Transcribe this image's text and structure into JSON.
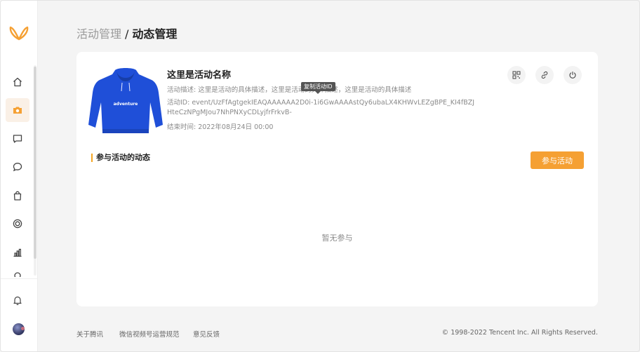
{
  "breadcrumb": {
    "parent": "活动管理",
    "separator": "/",
    "current": "动态管理"
  },
  "activity": {
    "title": "这里是活动名称",
    "description": "活动描述: 这里是活动的具体描述，这里是活动的具体描述，这里是活动的具体描述",
    "id_text": "活动ID: event/UzFfAgtgekIEAQAAAAAA2D0i-1i6GwAAAAstQy6ubaLX4KHWvLEZgBPE_KI4fBZJHteCzNPgMJou7NhPNXyCDLyjfrFrkvB-",
    "end_time": "结束时间: 2022年08月24日 00:00",
    "tooltip": "复制活动ID",
    "product_print": "adventure"
  },
  "section": {
    "title": "参与活动的动态",
    "join_label": "参与活动",
    "empty_text": "暂无参与"
  },
  "footer": {
    "links": [
      "关于腾讯",
      "微信视频号运营规范",
      "意见反馈"
    ],
    "copyright": "© 1998-2022 Tencent Inc. All Rights Reserved."
  },
  "sidebar": {
    "items": [
      "home-icon",
      "camera-icon",
      "message-square-icon",
      "chat-bubble-icon",
      "shopping-bag-icon",
      "target-icon",
      "bar-chart-icon",
      "settings-icon"
    ],
    "active": "camera-icon"
  },
  "colors": {
    "accent": "#f5a033",
    "active_nav_bg": "#faf0e6",
    "product_blue": "#1f4fd8"
  }
}
